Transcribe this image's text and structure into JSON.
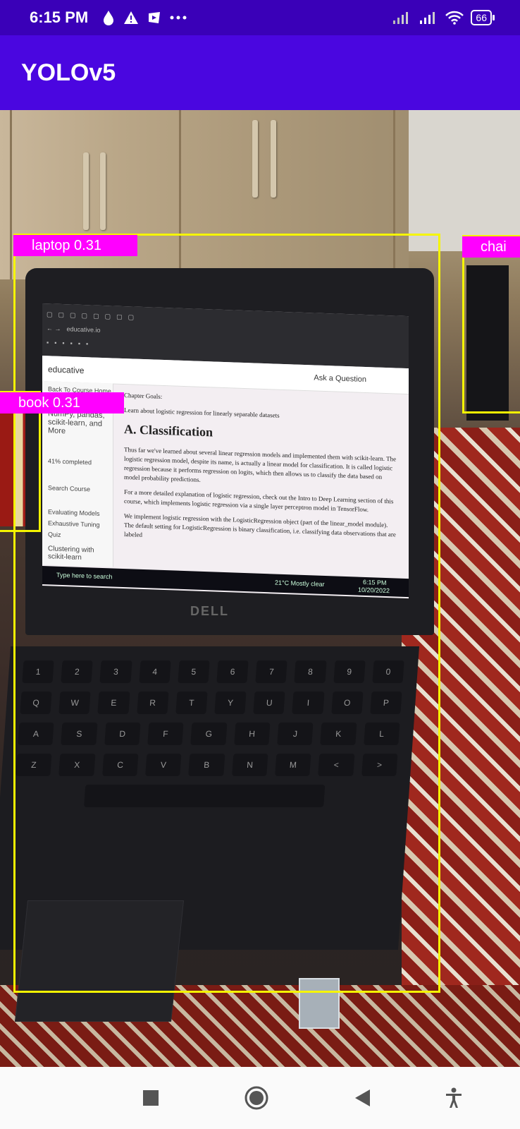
{
  "status_bar": {
    "time": "6:15 PM",
    "battery_level": "66",
    "left_icons": [
      "drop-icon",
      "alert-icon",
      "media-icon",
      "more-dots-icon"
    ],
    "right_icons": [
      "signal-icon",
      "signal-icon",
      "wifi-icon",
      "battery-icon"
    ]
  },
  "app_bar": {
    "title": "YOLOv5"
  },
  "detections": [
    {
      "label": "laptop 0.31",
      "class": "laptop",
      "confidence": 0.31
    },
    {
      "label": "book 0.31",
      "class": "book",
      "confidence": 0.31
    },
    {
      "label": "chai",
      "class": "chair"
    }
  ],
  "screen_content": {
    "site_logo": "educative",
    "ask_question": "Ask a Question",
    "sidebar_back": "Back To Course Home",
    "sidebar_title": "NumPy, pandas, scikit-learn, and More",
    "sidebar_progress": "41% completed",
    "sidebar_search": "Search Course",
    "sidebar_items": [
      "Evaluating Models",
      "Exhaustive Tuning",
      "Quiz",
      "Clustering with scikit-learn"
    ],
    "chapter_goals": "Chapter Goals:",
    "goal_item": "Learn about logistic regression for linearly separable datasets",
    "heading": "A. Classification",
    "para1": "Thus far we've learned about several linear regression models and implemented them with scikit-learn. The logistic regression model, despite its name, is actually a linear model for classification. It is called logistic regression because it performs regression on logits, which then allows us to classify the data based on model probability predictions.",
    "para2": "For a more detailed explanation of logistic regression, check out the Intro to Deep Learning section of this course, which implements logistic regression via a single layer perceptron model in TensorFlow.",
    "para3": "We implement logistic regression with the LogisticRegression object (part of the linear_model module). The default setting for LogisticRegression is binary classification, i.e. classifying data observations that are labeled",
    "taskbar_search": "Type here to search",
    "taskbar_weather": "21°C Mostly clear",
    "taskbar_time": "6:15 PM",
    "taskbar_date": "10/20/2022",
    "laptop_brand": "DELL"
  },
  "colors": {
    "status_bar": "#3a00b8",
    "app_bar": "#4a06e0",
    "bbox": "#f5f500",
    "label_bg": "#ff00ff"
  },
  "nav_bar": {
    "buttons": [
      "recents-square-icon",
      "home-circle-icon",
      "back-triangle-icon",
      "accessibility-icon"
    ]
  }
}
